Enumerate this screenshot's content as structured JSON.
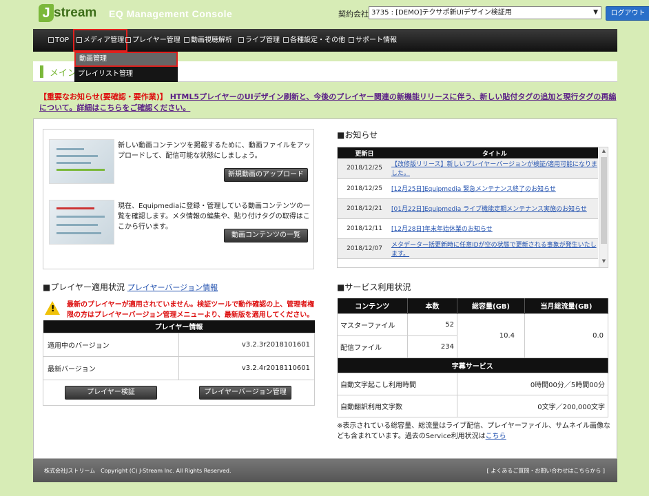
{
  "header": {
    "logo_j": "J",
    "logo_stream": "stream",
    "console_title": "EQ Management Console",
    "contract_label": "契約会社：",
    "contract_value": "3735 : [DEMO]テクサポ新UIデザイン検証用",
    "logout": "ログアウト"
  },
  "nav": {
    "items": [
      {
        "label": "TOP"
      },
      {
        "label": "メディア管理"
      },
      {
        "label": "プレイヤー管理"
      },
      {
        "label": "動画視聴解析"
      },
      {
        "label": "ライブ管理"
      },
      {
        "label": "各種設定・その他"
      },
      {
        "label": "サポート情報"
      }
    ],
    "dropdown": [
      {
        "label": "動画管理"
      },
      {
        "label": "プレイリスト管理"
      }
    ]
  },
  "page_title": "メイン",
  "notice": {
    "red": "【重要なお知らせ(要確認・要作業)】",
    "link": "HTML5プレイヤーのUIデザイン刷新と、今後のプレイヤー関連の新機能リリースに伴う、新しい貼付タグの追加と現行タグの再編について。詳細はこちらをご確認ください。"
  },
  "upload": {
    "text": "新しい動画コンテンツを掲載するために、動画ファイルをアップロードして、配信可能な状態にしましょう。",
    "button": "新規動画のアップロード"
  },
  "contents": {
    "text": "現在、Equipmediaに登録・管理している動画コンテンツの一覧を確認します。メタ情報の編集や、貼り付けタグの取得はここから行います。",
    "button": "動画コンテンツの一覧"
  },
  "news": {
    "heading": "■お知らせ",
    "col_date": "更新日",
    "col_title": "タイトル",
    "rows": [
      {
        "date": "2018/12/25",
        "title": "【改修版リリース】新しいプレイヤーバージョンが検証/適用可能になりました。"
      },
      {
        "date": "2018/12/25",
        "title": "[12月25日]Equipmedia 緊急メンテナンス終了のお知らせ"
      },
      {
        "date": "2018/12/21",
        "title": "[01月22日]Equipmedia ライブ機能定期メンテナンス実施のお知らせ"
      },
      {
        "date": "2018/12/11",
        "title": "[12月28日]年末年始休業のお知らせ"
      },
      {
        "date": "2018/12/07",
        "title": "メタデーター括更新時に任意IDが空の状態で更新される事象が発生いたします。"
      }
    ]
  },
  "player": {
    "heading": "■プレイヤー適用状況",
    "heading_link": "プレイヤーバージョン情報",
    "warning": "最新のプレイヤーが適用されていません。検証ツールで動作確認の上、管理者権限の方はプレイヤーバージョン管理メニューより、最新版を適用してください。",
    "table_title": "プレイヤー情報",
    "rows": [
      {
        "label": "適用中のバージョン",
        "value": "v3.2.3r2018101601"
      },
      {
        "label": "最新バージョン",
        "value": "v3.2.4r2018110601"
      }
    ],
    "btn_verify": "プレイヤー検証",
    "btn_manage": "プレイヤーバージョン管理"
  },
  "service": {
    "heading": "■サービス利用状況",
    "cols": [
      "コンテンツ",
      "本数",
      "総容量(GB)",
      "当月総流量(GB)"
    ],
    "master_label": "マスターファイル",
    "master_count": "52",
    "delivery_label": "配信ファイル",
    "delivery_count": "234",
    "total_capacity": "10.4",
    "monthly_traffic": "0.0",
    "subtitle_title": "字幕サービス",
    "transcribe_label": "自動文字起こし利用時間",
    "transcribe_value": "0時間00分／5時間00分",
    "translate_label": "自動翻訳利用文字数",
    "translate_value": "0文字／200,000文字",
    "caption": "※表示されている総容量、総流量はライブ配信、プレイヤーファイル、サムネイル画像なども含まれています。過去のService利用状況は",
    "caption_link": "こちら"
  },
  "footer": {
    "copyright": "株式会社Jストリーム　Copyright (C) J-Stream Inc. All Rights Reserved.",
    "faq": "[ よくあるご質問・お問い合わせはこちらから ]"
  }
}
